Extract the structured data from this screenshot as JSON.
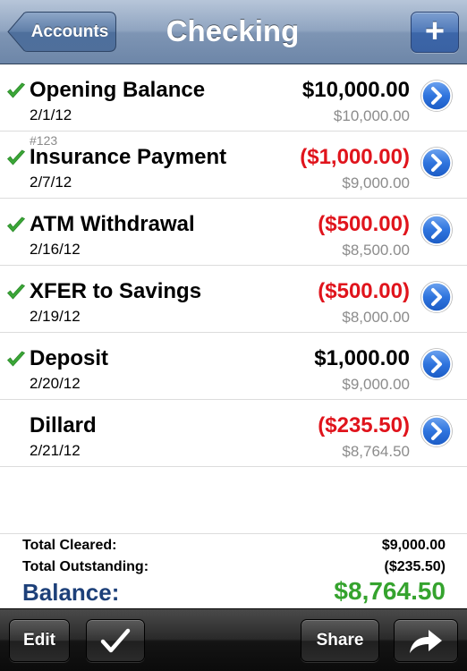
{
  "navbar": {
    "back_label": "Accounts",
    "title": "Checking",
    "add_label": "+"
  },
  "transactions": [
    {
      "memo": "",
      "payee": "Opening Balance",
      "date": "2/1/12",
      "amount": "$10,000.00",
      "running": "$10,000.00",
      "negative": false,
      "cleared": true
    },
    {
      "memo": "#123",
      "payee": "Insurance Payment",
      "date": "2/7/12",
      "amount": "($1,000.00)",
      "running": "$9,000.00",
      "negative": true,
      "cleared": true
    },
    {
      "memo": "",
      "payee": "ATM Withdrawal",
      "date": "2/16/12",
      "amount": "($500.00)",
      "running": "$8,500.00",
      "negative": true,
      "cleared": true
    },
    {
      "memo": "",
      "payee": "XFER to Savings",
      "date": "2/19/12",
      "amount": "($500.00)",
      "running": "$8,000.00",
      "negative": true,
      "cleared": true
    },
    {
      "memo": "",
      "payee": "Deposit",
      "date": "2/20/12",
      "amount": "$1,000.00",
      "running": "$9,000.00",
      "negative": false,
      "cleared": true
    },
    {
      "memo": "",
      "payee": "Dillard",
      "date": "2/21/12",
      "amount": "($235.50)",
      "running": "$8,764.50",
      "negative": true,
      "cleared": false
    }
  ],
  "totals": {
    "cleared_label": "Total Cleared:",
    "cleared_value": "$9,000.00",
    "outstanding_label": "Total Outstanding:",
    "outstanding_value": "($235.50)",
    "balance_label": "Balance:",
    "balance_value": "$8,764.50"
  },
  "toolbar": {
    "edit_label": "Edit",
    "share_label": "Share"
  },
  "colors": {
    "negative": "#e0141c",
    "balance_label": "#1d4079",
    "balance_value": "#35a32e",
    "cleared_check": "#3aa637",
    "disclosure": "#2a6fd6"
  },
  "icons": {
    "cleared": "checkmark-icon",
    "disclosure": "chevron-right-circle-icon",
    "toolbar_check": "checkmark-icon",
    "toolbar_forward": "forward-arrow-icon"
  }
}
